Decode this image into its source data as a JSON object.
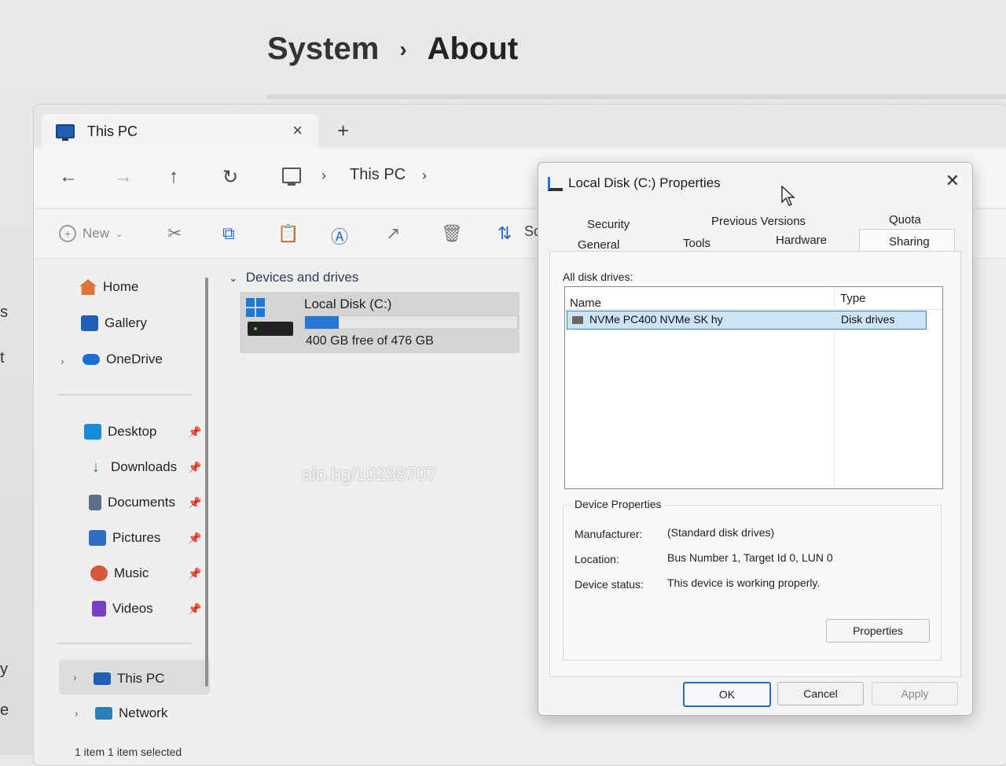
{
  "settings": {
    "breadcrumb": [
      "System",
      "About"
    ],
    "left_clipped": [
      "s",
      "t",
      "y",
      "e"
    ]
  },
  "explorer": {
    "tab": {
      "title": "This PC",
      "close": "×"
    },
    "new_tab": "+",
    "nav": {
      "back": "←",
      "forward": "→",
      "up": "↑",
      "refresh": "↻",
      "address": "This PC",
      "sep": "›"
    },
    "toolbar": {
      "new_label": "New",
      "sort_label": "Sc"
    },
    "sidebar": {
      "items": [
        {
          "label": "Home"
        },
        {
          "label": "Gallery"
        },
        {
          "label": "OneDrive"
        },
        {
          "label": "Desktop"
        },
        {
          "label": "Downloads"
        },
        {
          "label": "Documents"
        },
        {
          "label": "Pictures"
        },
        {
          "label": "Music"
        },
        {
          "label": "Videos"
        },
        {
          "label": "This PC"
        },
        {
          "label": "Network"
        }
      ]
    },
    "section_title": "Devices and drives",
    "drive": {
      "name": "Local Disk (C:)",
      "free_text": "400 GB free of 476 GB",
      "used_fraction": 0.16
    },
    "watermark": "alo.bg/10288707",
    "status": "1 item   1 item selected"
  },
  "dialog": {
    "title": "Local Disk (C:) Properties",
    "tabs": {
      "row1": [
        "Security",
        "Previous Versions",
        "Quota"
      ],
      "row2": [
        "General",
        "Tools",
        "Hardware",
        "Sharing"
      ]
    },
    "all_disk_drives_label": "All disk drives:",
    "columns": [
      "Name",
      "Type"
    ],
    "rows": [
      {
        "name": "NVMe PC400 NVMe SK hy",
        "type": "Disk drives"
      }
    ],
    "device_properties": {
      "title": "Device Properties",
      "manufacturer_label": "Manufacturer:",
      "manufacturer": "(Standard disk drives)",
      "location_label": "Location:",
      "location": "Bus Number 1, Target Id 0, LUN 0",
      "status_label": "Device status:",
      "status": "This device is working properly.",
      "properties_button": "Properties"
    },
    "buttons": {
      "ok": "OK",
      "cancel": "Cancel",
      "apply": "Apply"
    }
  }
}
